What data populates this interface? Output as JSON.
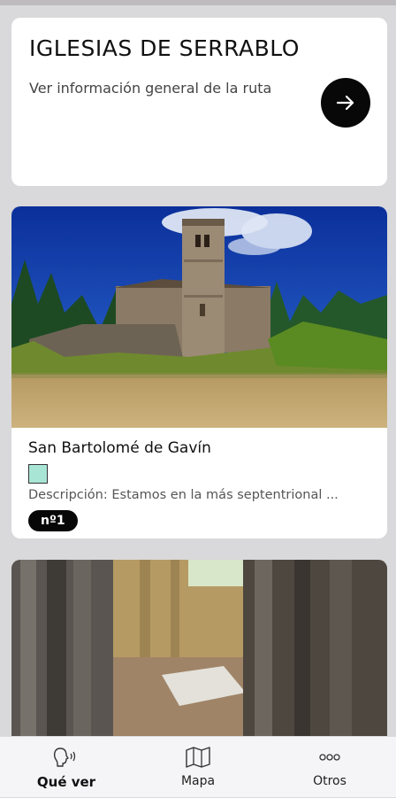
{
  "route": {
    "title": "IGLESIAS DE SERRABLO",
    "subtitle": "Ver información general de la ruta",
    "arrow_icon": "arrow-right-icon"
  },
  "places": [
    {
      "name": "San Bartolomé de Gavín",
      "swatch_color": "#a9e5d5",
      "description": "Descripción: Estamos en la más septentrional ...",
      "number": "nº1"
    }
  ],
  "nav": {
    "items": [
      {
        "label": "Qué ver",
        "icon": "audio-guide-icon",
        "active": true
      },
      {
        "label": "Mapa",
        "icon": "map-icon",
        "active": false
      },
      {
        "label": "Otros",
        "icon": "more-icon",
        "active": false
      }
    ]
  },
  "colors": {
    "background": "#d9d8da",
    "card": "#ffffff",
    "accent": "#080808",
    "swatch": "#a9e5d5"
  }
}
